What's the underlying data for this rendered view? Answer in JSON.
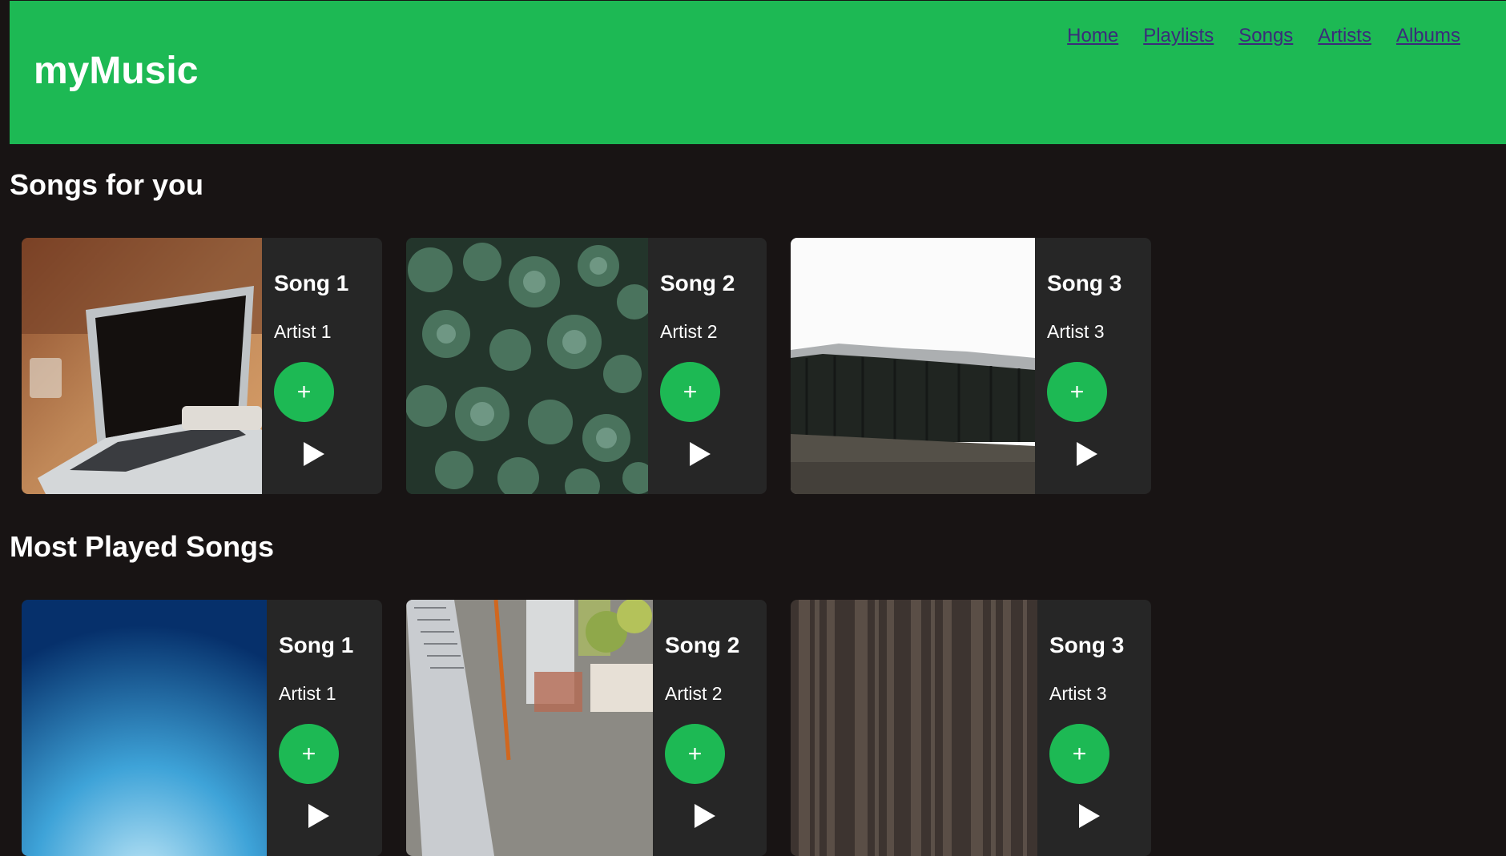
{
  "app": {
    "title": "myMusic"
  },
  "nav": {
    "items": [
      "Home",
      "Playlists",
      "Songs",
      "Artists",
      "Albums"
    ]
  },
  "sections": [
    {
      "title": "Songs for you",
      "cards": [
        {
          "song": "Song 1",
          "artist": "Artist 1",
          "add_label": "+",
          "image": "laptop-on-desk"
        },
        {
          "song": "Song 2",
          "artist": "Artist 2",
          "add_label": "+",
          "image": "succulent-plants"
        },
        {
          "song": "Song 3",
          "artist": "Artist 3",
          "add_label": "+",
          "image": "forest-field"
        }
      ]
    },
    {
      "title": "Most Played Songs",
      "cards": [
        {
          "song": "Song 1",
          "artist": "Artist 1",
          "add_label": "+",
          "image": "blue-sky"
        },
        {
          "song": "Song 2",
          "artist": "Artist 2",
          "add_label": "+",
          "image": "city-buildings-aerial"
        },
        {
          "song": "Song 3",
          "artist": "Artist 3",
          "add_label": "+",
          "image": "forest-trees"
        }
      ]
    }
  ],
  "colors": {
    "accent": "#1db954",
    "background": "#181414",
    "card": "#262626",
    "link": "#3a2c7a"
  }
}
